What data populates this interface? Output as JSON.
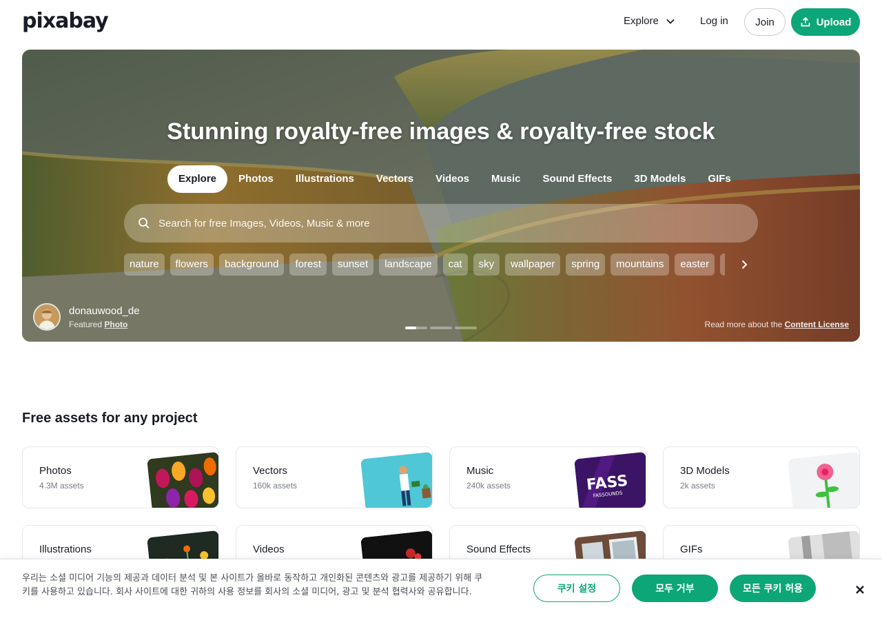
{
  "header": {
    "logo": "pixabay",
    "explore_label": "Explore",
    "login_label": "Log in",
    "join_label": "Join",
    "upload_label": "Upload"
  },
  "hero": {
    "title": "Stunning royalty-free images & royalty-free stock",
    "tabs": [
      "Explore",
      "Photos",
      "Illustrations",
      "Vectors",
      "Videos",
      "Music",
      "Sound Effects",
      "3D Models",
      "GIFs"
    ],
    "active_tab": "Explore",
    "search_placeholder": "Search for free Images, Videos, Music & more",
    "tags": [
      "nature",
      "flowers",
      "background",
      "forest",
      "sunset",
      "landscape",
      "cat",
      "sky",
      "wallpaper",
      "spring",
      "mountains",
      "easter",
      "i"
    ],
    "author": {
      "name": "donauwood_de",
      "featured_prefix": "Featured",
      "featured_link": "Photo"
    },
    "carousel": {
      "slides": 3,
      "active": 1,
      "active_progress": 0.5
    },
    "license_prefix": "Read more about the",
    "license_link": "Content License"
  },
  "assets": {
    "title": "Free assets for any project",
    "cards": [
      {
        "name": "Photos",
        "count": "4.3M assets",
        "thumb": "tulips-photo"
      },
      {
        "name": "Vectors",
        "count": "160k assets",
        "thumb": "gardener-vector"
      },
      {
        "name": "Music",
        "count": "240k assets",
        "thumb": "fassounds-cover"
      },
      {
        "name": "3D Models",
        "count": "2k assets",
        "thumb": "flower-3d"
      },
      {
        "name": "Illustrations",
        "count": "",
        "thumb": "flower-illustration"
      },
      {
        "name": "Videos",
        "count": "",
        "thumb": "flower-video"
      },
      {
        "name": "Sound Effects",
        "count": "",
        "thumb": "room-photo"
      },
      {
        "name": "GIFs",
        "count": "",
        "thumb": "gif-thumb"
      }
    ]
  },
  "cookie": {
    "text": "우리는 소셜 미디어 기능의 제공과 데이터 분석 및 본 사이트가 올바로 동작하고 개인화된 콘텐츠와 광고를 제공하기 위해 쿠키를 사용하고 있습니다. 회사 사이트에 대한 귀하의 사용 정보를 회사의 소셜 미디어, 광고 및 분석 협력사와 공유합니다.",
    "settings_label": "쿠키 설정",
    "reject_label": "모두 거부",
    "accept_label": "모든 쿠키 허용"
  },
  "colors": {
    "accent": "#0ca678",
    "text": "#191b26",
    "muted": "#767a85"
  }
}
